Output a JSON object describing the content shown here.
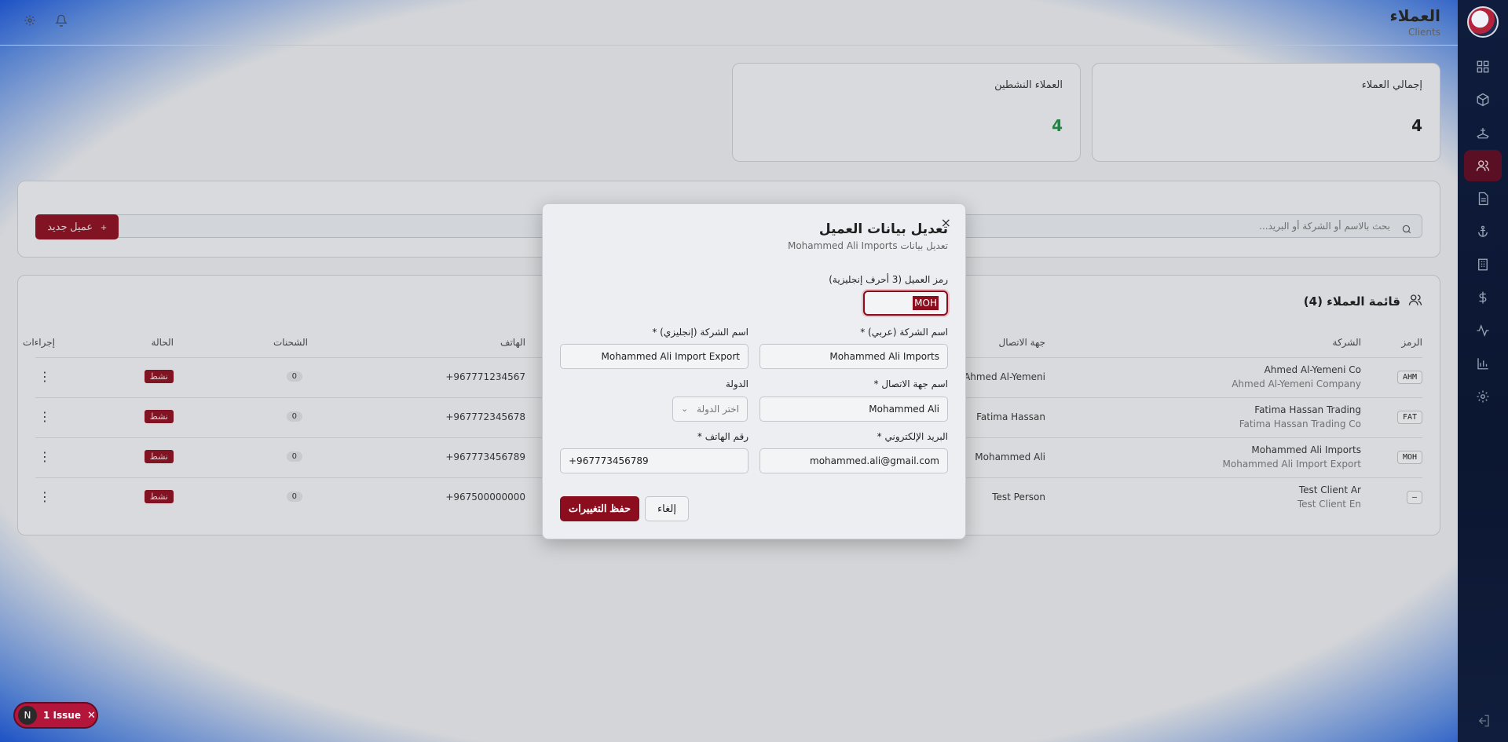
{
  "header": {
    "title": "العملاء",
    "subtitle": "Clients"
  },
  "stats": {
    "total_label": "إجمالي العملاء",
    "total_value": "4",
    "active_label": "العملاء النشطين",
    "active_value": "4"
  },
  "toolbar": {
    "search_placeholder": "بحث بالاسم أو الشركة أو البريد...",
    "new_client_label": "عميل جديد",
    "new_client_icon": "+"
  },
  "list": {
    "title": "قائمة العملاء (4)",
    "columns": {
      "code": "الرمز",
      "company": "الشركة",
      "contact": "جهة الاتصال",
      "phone": "الهاتف",
      "shipments": "الشحنات",
      "status": "الحالة",
      "actions": "إجراءات"
    },
    "rows": [
      {
        "code": "AHM",
        "company": "Ahmed Al-Yemeni Co",
        "company_en": "Ahmed Al-Yemeni Company",
        "contact": "Ahmed Al-Yemeni",
        "phone": "+967771234567",
        "shipments": "0",
        "status": "نشط"
      },
      {
        "code": "FAT",
        "company": "Fatima Hassan Trading",
        "company_en": "Fatima Hassan Trading Co",
        "contact": "Fatima Hassan",
        "phone": "+967772345678",
        "shipments": "0",
        "status": "نشط"
      },
      {
        "code": "MOH",
        "company": "Mohammed Ali Imports",
        "company_en": "Mohammed Ali Import Export",
        "contact": "Mohammed Ali",
        "phone": "+967773456789",
        "shipments": "0",
        "status": "نشط"
      },
      {
        "code": "—",
        "company": "Test Client Ar",
        "company_en": "Test Client En",
        "contact": "Test Person",
        "phone": "+967500000000",
        "shipments": "0",
        "status": "نشط"
      }
    ]
  },
  "modal": {
    "title": "تعديل بيانات العميل",
    "subtitle": "تعديل بيانات Mohammed Ali Imports",
    "close_icon": "×",
    "code_label": "رمز العميل (3 أحرف إنجليزية)",
    "code_value": "MOH",
    "company_ar_label": "اسم الشركة (عربي) *",
    "company_ar_value": "Mohammed Ali Imports",
    "company_en_label": "اسم الشركة (إنجليزي) *",
    "company_en_value": "Mohammed Ali Import Export",
    "contact_label": "اسم جهة الاتصال *",
    "contact_value": "Mohammed Ali",
    "country_label": "الدولة",
    "country_placeholder": "اختر الدولة",
    "email_label": "البريد الإلكتروني *",
    "email_value": "mohammed.ali@gmail.com",
    "phone_label": "رقم الهاتف *",
    "phone_value": "+967773456789",
    "save_label": "حفظ التغييرات",
    "cancel_label": "إلغاء"
  },
  "issue": {
    "badge": "N",
    "label": "1 Issue",
    "close": "✕"
  },
  "colors": {
    "brand": "#8b0d1e",
    "sidebar": "#0f1c3d",
    "active_green": "#1d8f43"
  }
}
